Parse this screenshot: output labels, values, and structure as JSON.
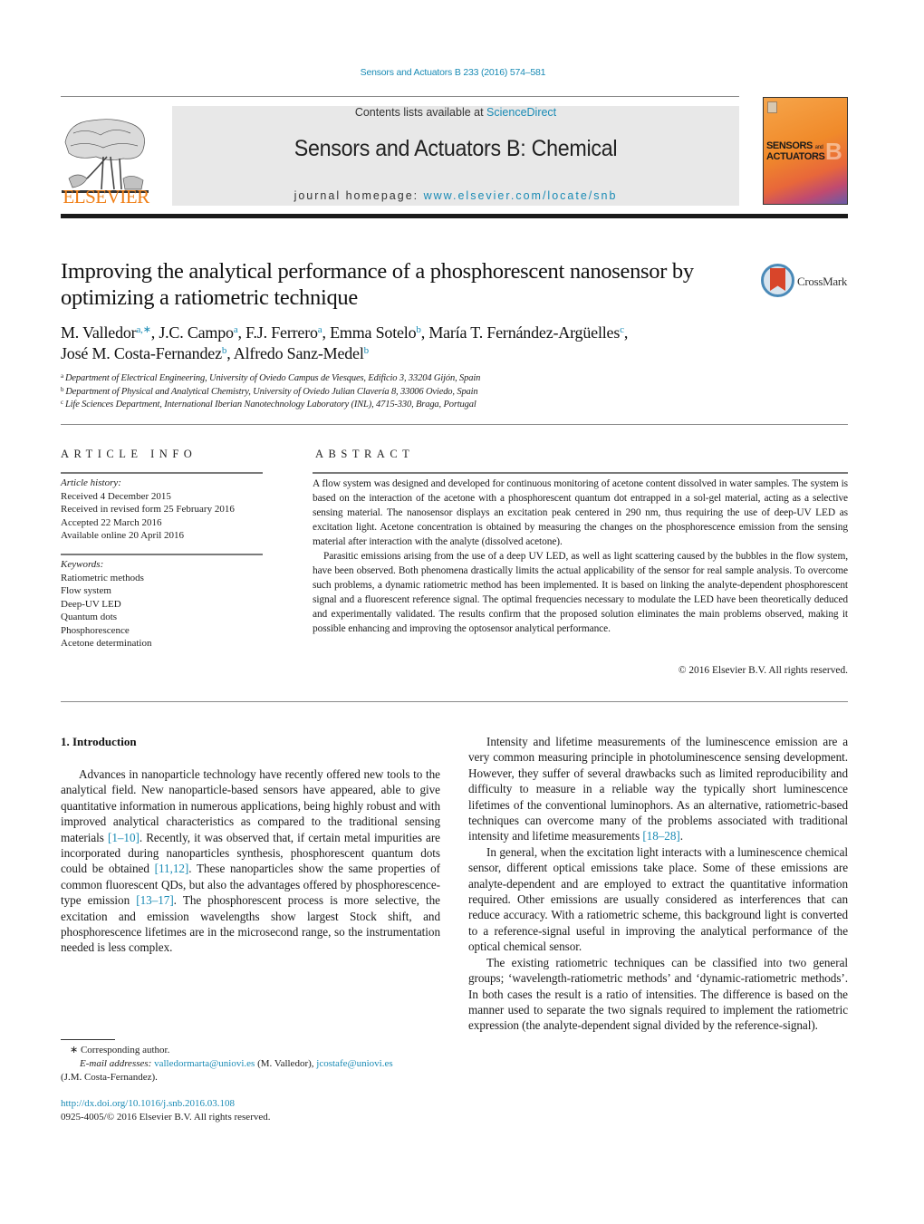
{
  "header": {
    "citation": "Sensors and Actuators B 233 (2016) 574–581",
    "contents_prefix": "Contents lists available at ",
    "contents_link": "ScienceDirect",
    "journal_title": "Sensors and Actuators B: Chemical",
    "homepage_prefix": "journal homepage: ",
    "homepage_link": "www.elsevier.com/locate/snb",
    "publisher_logo_text": "ELSEVIER",
    "cover": {
      "line1": "SENSORS",
      "and": "and",
      "line2": "ACTUATORS",
      "letter": "B"
    },
    "colors": {
      "link": "#1a8bb5",
      "elsevier_orange": "#f07f16",
      "banner_gray": "#e8e8e8"
    }
  },
  "article": {
    "title": "Improving the analytical performance of a phosphorescent nanosensor by optimizing a ratiometric technique",
    "crossmark_label": "CrossMark",
    "authors": [
      {
        "name": "M. Valledor",
        "sup": "a,∗",
        "sep": ", "
      },
      {
        "name": "J.C. Campo",
        "sup": "a",
        "sep": ", "
      },
      {
        "name": "F.J. Ferrero",
        "sup": "a",
        "sep": ", "
      },
      {
        "name": "Emma Sotelo",
        "sup": "b",
        "sep": ", "
      },
      {
        "name": "María T. Fernández-Argüelles",
        "sup": "c",
        "sep": ","
      },
      {
        "name": "José M. Costa-Fernandez",
        "sup": "b",
        "sep": ", "
      },
      {
        "name": "Alfredo Sanz-Medel",
        "sup": "b",
        "sep": ""
      }
    ],
    "affiliations": [
      {
        "key": "a",
        "text": "Department of Electrical Engineering, University of Oviedo Campus de Viesques, Edificio 3, 33204 Gijón, Spain"
      },
      {
        "key": "b",
        "text": "Department of Physical and Analytical Chemistry, University of Oviedo Julian Clavería 8, 33006 Oviedo, Spain"
      },
      {
        "key": "c",
        "text": "Life Sciences Department, International Iberian Nanotechnology Laboratory (INL), 4715-330, Braga, Portugal"
      }
    ]
  },
  "article_info": {
    "heading": "ARTICLE INFO",
    "history_label": "Article history:",
    "history": [
      "Received 4 December 2015",
      "Received in revised form 25 February 2016",
      "Accepted 22 March 2016",
      "Available online 20 April 2016"
    ],
    "keywords_label": "Keywords:",
    "keywords": [
      "Ratiometric methods",
      "Flow system",
      "Deep-UV LED",
      "Quantum dots",
      "Phosphorescence",
      "Acetone determination"
    ]
  },
  "abstract": {
    "heading": "ABSTRACT",
    "paragraphs": [
      "A flow system was designed and developed for continuous monitoring of acetone content dissolved in water samples. The system is based on the interaction of the acetone with a phosphorescent quantum dot entrapped in a sol-gel material, acting as a selective sensing material. The nanosensor displays an excitation peak centered in 290 nm, thus requiring the use of deep-UV LED as excitation light. Acetone concentration is obtained by measuring the changes on the phosphorescence emission from the sensing material after interaction with the analyte (dissolved acetone).",
      "Parasitic emissions arising from the use of a deep UV LED, as well as light scattering caused by the bubbles in the flow system, have been observed. Both phenomena drastically limits the actual applicability of the sensor for real sample analysis. To overcome such problems, a dynamic ratiometric method has been implemented. It is based on linking the analyte-dependent phosphorescent signal and a fluorescent reference signal. The optimal frequencies necessary to modulate the LED have been theoretically deduced and experimentally validated. The results confirm that the proposed solution eliminates the main problems observed, making it possible enhancing and improving the optosensor analytical performance."
    ],
    "copyright": "© 2016 Elsevier B.V. All rights reserved."
  },
  "body": {
    "section_heading": "1.  Introduction",
    "left_paragraphs": [
      [
        {
          "t": "Advances in nanoparticle technology have recently offered new tools to the analytical field. New nanoparticle-based sensors have appeared, able to give quantitative information in numerous applications, being highly robust and with improved analytical characteristics as compared to the traditional sensing materials "
        },
        {
          "ref": "[1–10]"
        },
        {
          "t": ". Recently, it was observed that, if certain metal impurities are incorporated during nanoparticles synthesis, phosphorescent quantum dots could be obtained "
        },
        {
          "ref": "[11,12]"
        },
        {
          "t": ". These nanoparticles show the same properties of common fluorescent QDs, but also the advantages offered by phosphorescence-type emission "
        },
        {
          "ref": "[13–17]"
        },
        {
          "t": ". The phosphorescent process is more selective, the excitation and emission wavelengths show largest Stock shift, and phosphorescence lifetimes are in the microsecond range, so the instrumentation needed is less complex."
        }
      ]
    ],
    "right_paragraphs": [
      [
        {
          "t": "Intensity and lifetime measurements of the luminescence emission are a very common measuring principle in photoluminescence sensing development. However, they suffer of several drawbacks such as limited reproducibility and difficulty to measure in a reliable way the typically short luminescence lifetimes of the conventional luminophors. As an alternative, ratiometric-based techniques can overcome many of the problems associated with traditional intensity and lifetime measurements "
        },
        {
          "ref": "[18–28]"
        },
        {
          "t": "."
        }
      ],
      [
        {
          "t": "In general, when the excitation light interacts with a luminescence chemical sensor, different optical emissions take place. Some of these emissions are analyte-dependent and are employed to extract the quantitative information required. Other emissions are usually considered as interferences that can reduce accuracy. With a ratiometric scheme, this background light is converted to a reference-signal useful in improving the analytical performance of the optical chemical sensor."
        }
      ],
      [
        {
          "t": "The existing ratiometric techniques can be classified into two general groups; ‘wavelength-ratiometric methods’ and ‘dynamic-ratiometric methods’. In both cases the result is a ratio of intensities. The difference is based on the manner used to separate the two signals required to implement the ratiometric expression (the analyte-dependent signal divided by the reference-signal)."
        }
      ]
    ]
  },
  "footnote": {
    "corresponding_marker": "∗",
    "corresponding_text": "Corresponding author.",
    "email_label": "E-mail addresses:",
    "email1": "valledormarta@uniovi.es",
    "email1_owner": " (M. Valledor), ",
    "email2": "jcostafe@uniovi.es",
    "email2_owner": "(J.M. Costa-Fernandez).",
    "doi": "http://dx.doi.org/10.1016/j.snb.2016.03.108",
    "issn_line": "0925-4005/© 2016 Elsevier B.V. All rights reserved."
  }
}
